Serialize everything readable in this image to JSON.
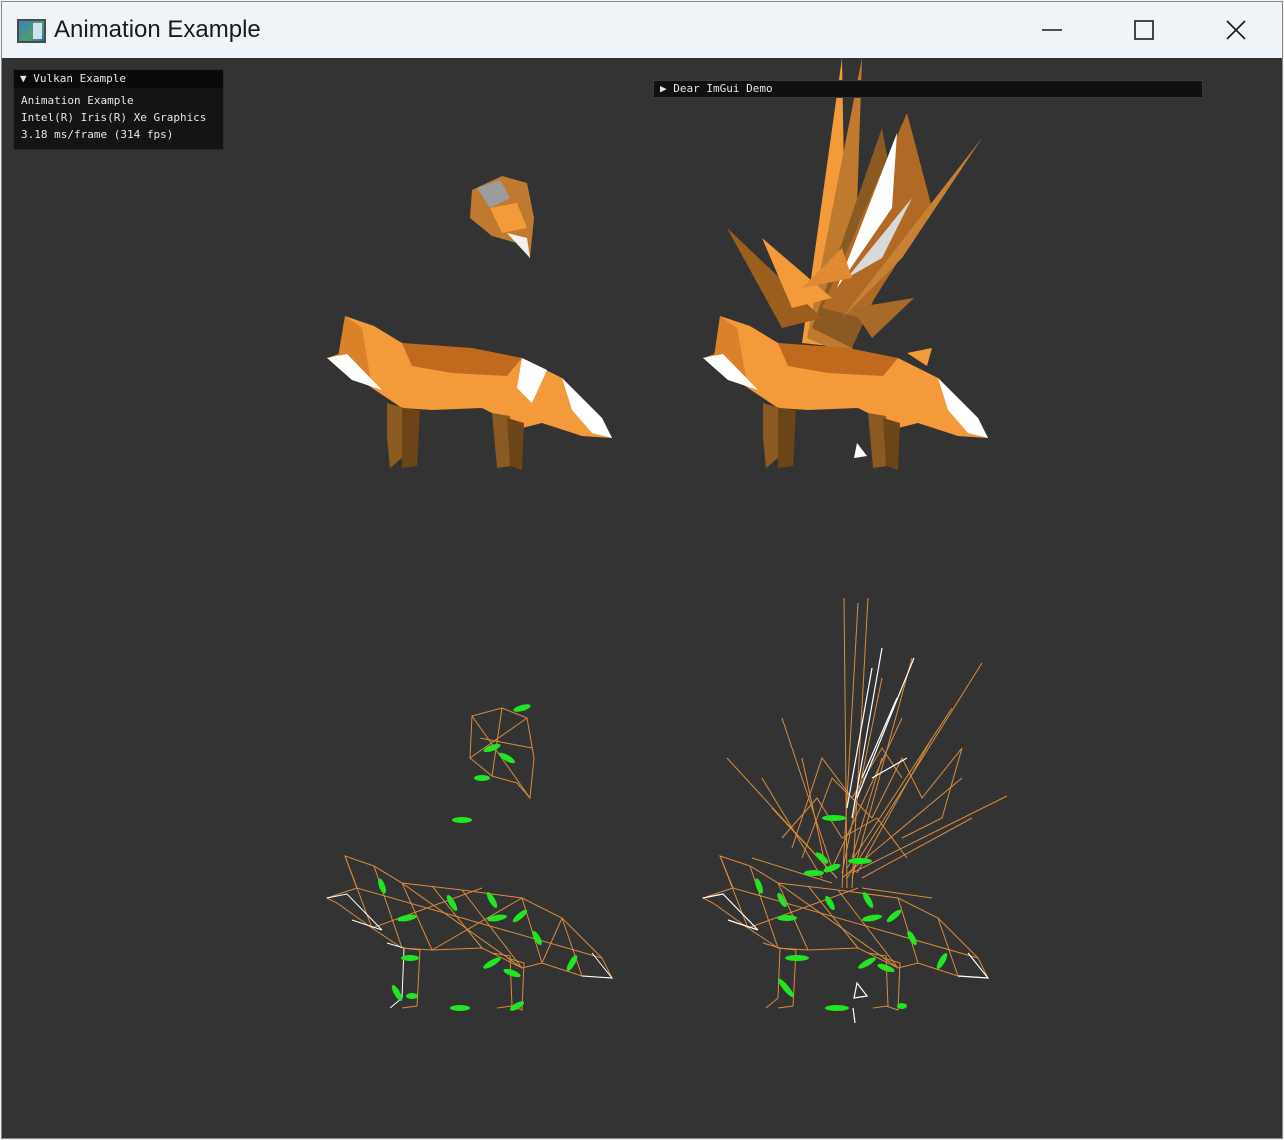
{
  "window": {
    "title": "Animation Example",
    "controls": {
      "minimize": "minimize-icon",
      "maximize": "maximize-icon",
      "close": "close-icon"
    }
  },
  "overlay": {
    "header_arrow": "▼",
    "header": "Vulkan Example",
    "lines": [
      "Animation Example",
      "Intel(R) Iris(R) Xe Graphics",
      "3.18 ms/frame (314 fps)"
    ]
  },
  "demo_window": {
    "arrow": "▶",
    "title": "Dear ImGui Demo"
  },
  "colors": {
    "background": "#333333",
    "fox_orange": "#f39a3a",
    "fox_dark": "#8a5a22",
    "wire_orange": "#d98b3f",
    "joint_green": "#22e622"
  }
}
